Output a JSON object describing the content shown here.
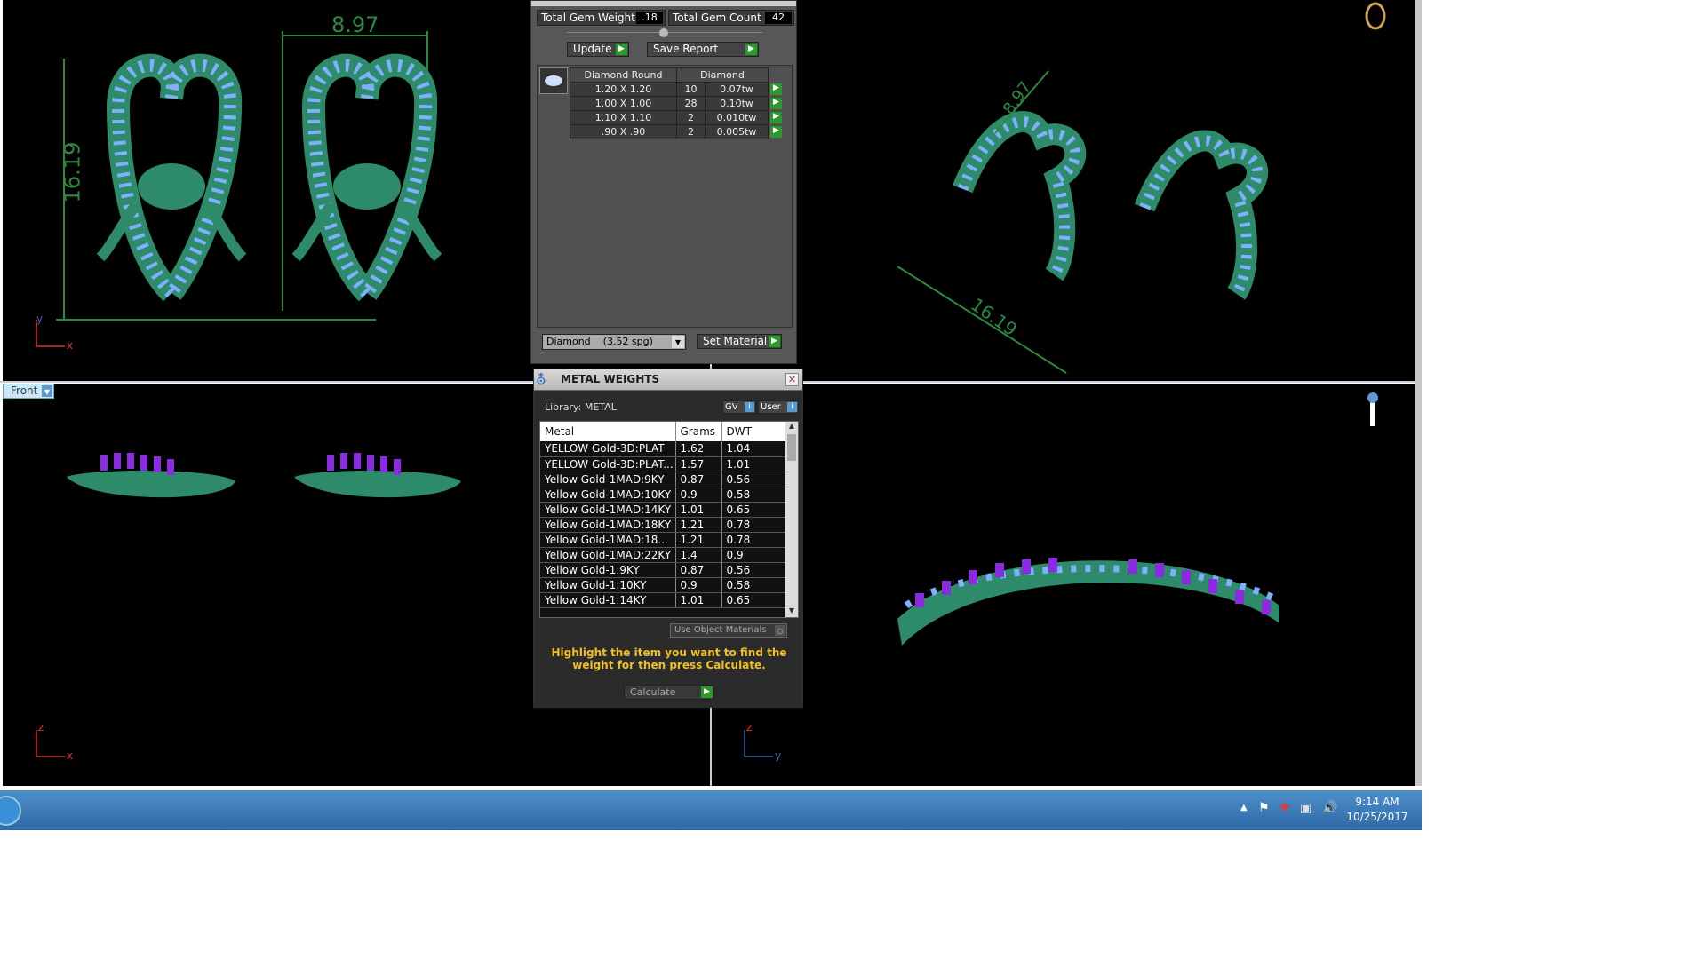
{
  "viewports": {
    "top_left": {
      "dim_width": "8.97",
      "dim_height": "16.19",
      "axis_h": "x",
      "axis_v": "y"
    },
    "top_right": {
      "dim_width": "8.97",
      "dim_height": "16.19"
    },
    "bottom_left": {
      "view_label": "Front",
      "axis_h": "x",
      "axis_v": "z"
    },
    "bottom_right": {
      "axis_h": "y",
      "axis_v": "z"
    }
  },
  "gem_panel": {
    "total_weight_label": "Total Gem Weight",
    "total_weight": ".18",
    "total_count_label": "Total Gem Count",
    "total_count": "42",
    "update_label": "Update",
    "save_report_label": "Save Report",
    "header_shape": "Diamond Round",
    "header_material": "Diamond",
    "rows": [
      {
        "size": "1.20 X 1.20",
        "count": "10",
        "weight": "0.07tw"
      },
      {
        "size": "1.00 X 1.00",
        "count": "28",
        "weight": "0.10tw"
      },
      {
        "size": "1.10 X 1.10",
        "count": "2",
        "weight": "0.010tw"
      },
      {
        "size": ".90 X .90",
        "count": "2",
        "weight": "0.005tw"
      }
    ],
    "material_select": "Diamond    (3.52 spg)",
    "set_material_label": "Set Material"
  },
  "metal_weights": {
    "title": "METAL WEIGHTS",
    "library": "Library: METAL",
    "gv_label": "GV",
    "user_label": "User",
    "columns": [
      "Metal",
      "Grams",
      "DWT"
    ],
    "rows": [
      [
        "YELLOW Gold-3D:PLAT",
        "1.62",
        "1.04"
      ],
      [
        "YELLOW Gold-3D:PLAT...",
        "1.57",
        "1.01"
      ],
      [
        "Yellow Gold-1MAD:9KY",
        "0.87",
        "0.56"
      ],
      [
        "Yellow Gold-1MAD:10KY",
        "0.9",
        "0.58"
      ],
      [
        "Yellow Gold-1MAD:14KY",
        "1.01",
        "0.65"
      ],
      [
        "Yellow Gold-1MAD:18KY",
        "1.21",
        "0.78"
      ],
      [
        "Yellow Gold-1MAD:18...",
        "1.21",
        "0.78"
      ],
      [
        "Yellow Gold-1MAD:22KY",
        "1.4",
        "0.9"
      ],
      [
        "Yellow Gold-1:9KY",
        "0.87",
        "0.56"
      ],
      [
        "Yellow Gold-1:10KY",
        "0.9",
        "0.58"
      ],
      [
        "Yellow Gold-1:14KY",
        "1.01",
        "0.65"
      ]
    ],
    "use_object_materials": "Use Object Materials",
    "hint": "Highlight the item you want to find the weight for then press Calculate.",
    "calculate_label": "Calculate"
  },
  "taskbar": {
    "time": "9:14 AM",
    "date": "10/25/2017"
  },
  "colors": {
    "metal": "#2e8b6a",
    "gem": "#7fb0ff",
    "prong": "#8a2be2",
    "dim": "#2a8a40"
  }
}
